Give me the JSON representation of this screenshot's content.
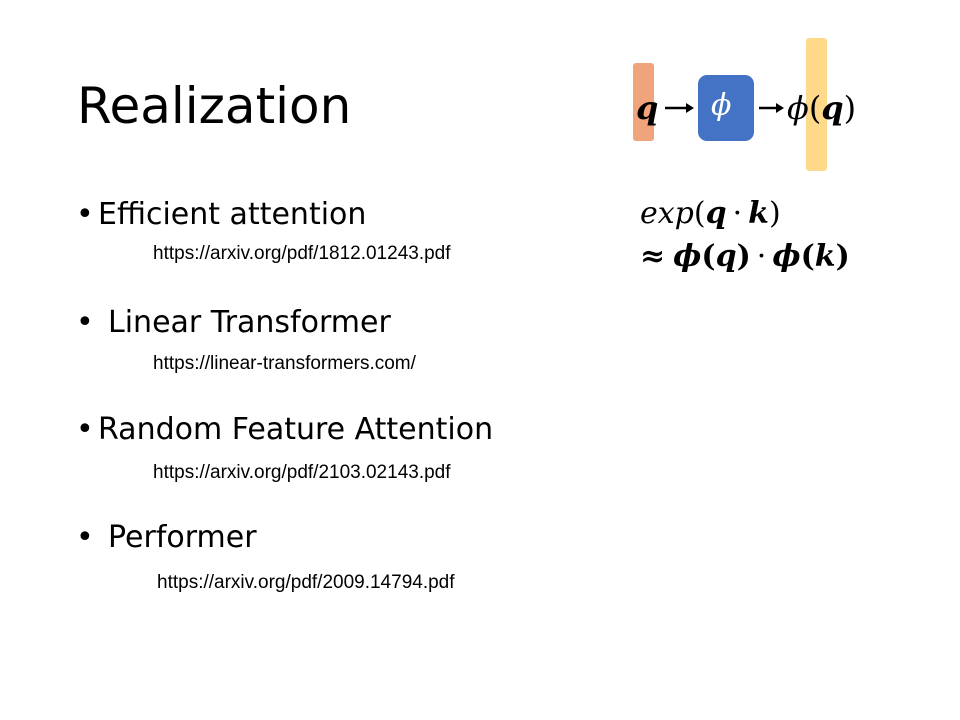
{
  "slide": {
    "title": "Realization",
    "bullets": [
      {
        "label": "Efficient attention",
        "link": "https://arxiv.org/pdf/1812.01243.pdf"
      },
      {
        "label": "Linear Transformer",
        "link": "https://linear-transformers.com/"
      },
      {
        "label": "Random Feature Attention",
        "link": "https://arxiv.org/pdf/2103.02143.pdf"
      },
      {
        "label": "Performer",
        "link": "https://arxiv.org/pdf/2009.14794.pdf"
      }
    ],
    "bullet_symbol": "•",
    "diagram": {
      "input": "q",
      "function": "ϕ",
      "output_func": "ϕ",
      "output_arg": "q",
      "input_bar_color": "#f0a47c",
      "function_box_color": "#4472c4",
      "output_bar_color": "#ffd98a"
    },
    "formula": {
      "line1_exp": "exp",
      "line1_q": "q",
      "line1_dot": "·",
      "line1_k": "k",
      "line2_approx": "≈",
      "line2_phi1": "ϕ",
      "line2_q": "q",
      "line2_dot": "·",
      "line2_phi2": "ϕ",
      "line2_k": "k",
      "open_paren": "(",
      "close_paren": ")"
    }
  }
}
